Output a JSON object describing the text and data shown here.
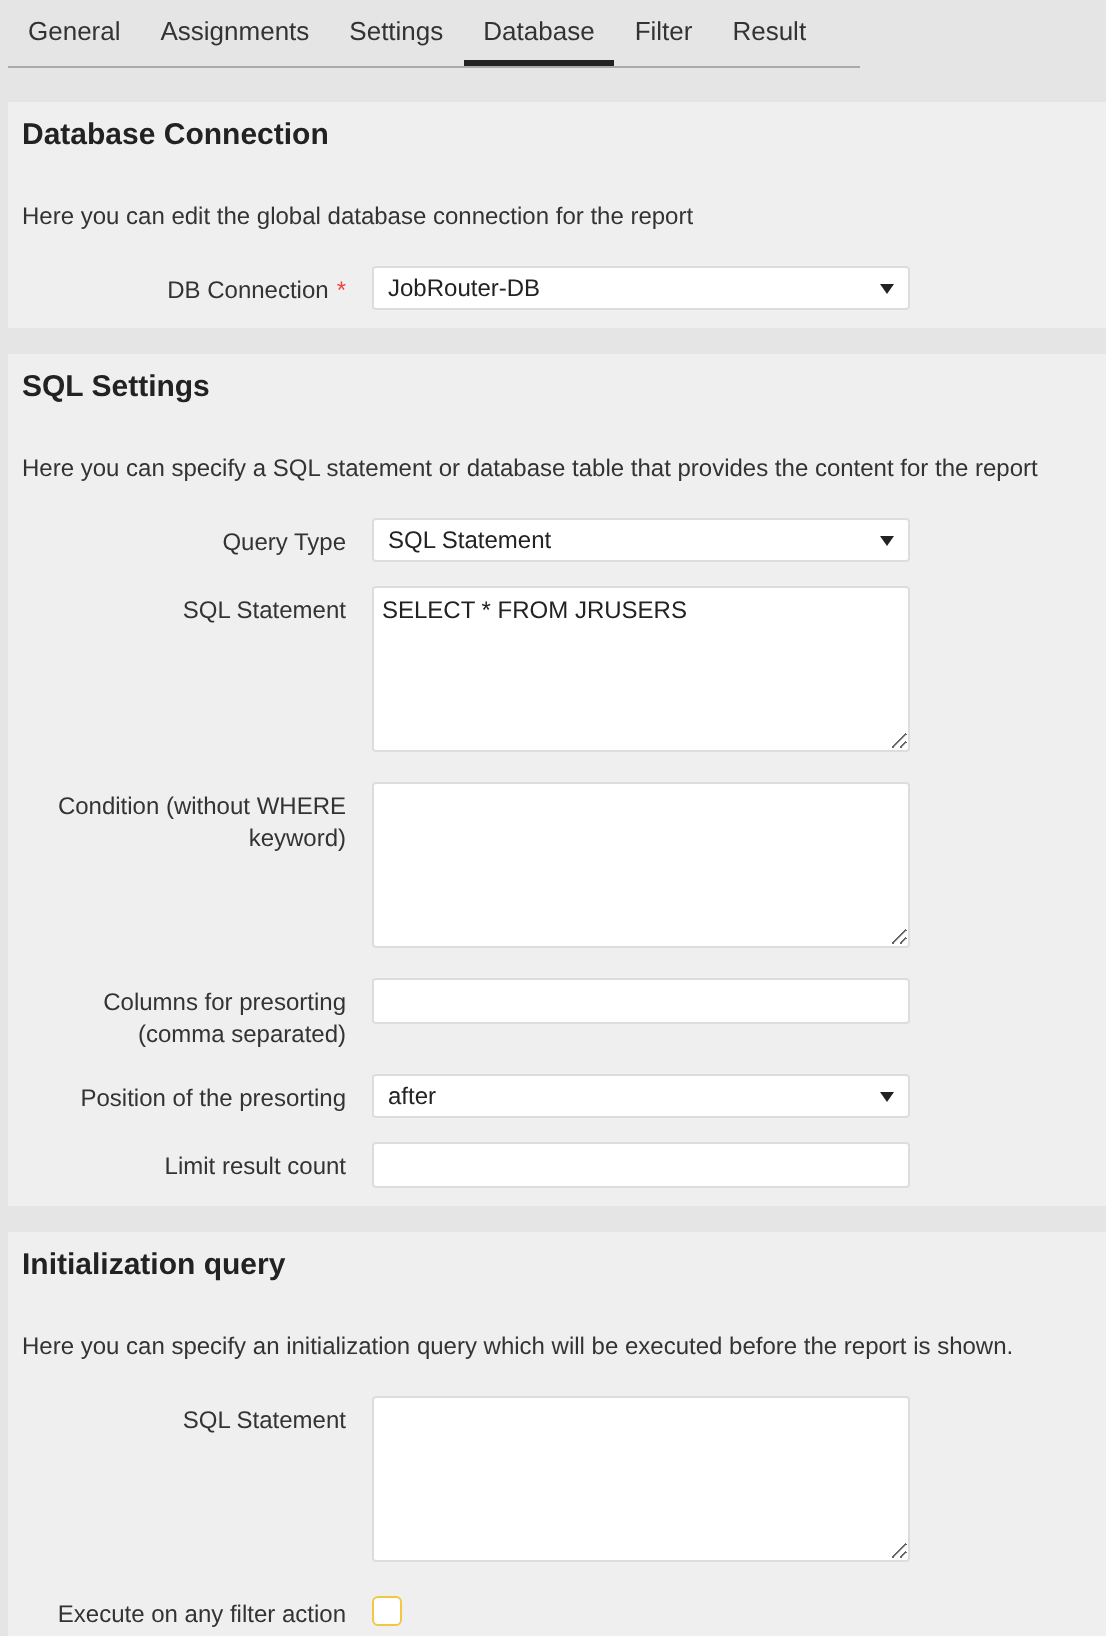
{
  "tabs": [
    {
      "label": "General",
      "selected": false
    },
    {
      "label": "Assignments",
      "selected": false
    },
    {
      "label": "Settings",
      "selected": false
    },
    {
      "label": "Database",
      "selected": true
    },
    {
      "label": "Filter",
      "selected": false
    },
    {
      "label": "Result",
      "selected": false
    }
  ],
  "sections": [
    {
      "title": "Database Connection",
      "description": "Here you can edit the global database connection for the report",
      "fields": [
        {
          "kind": "select",
          "label": "DB Connection",
          "required_mark": "*",
          "value": "JobRouter-DB"
        }
      ]
    },
    {
      "title": "SQL Settings",
      "description": "Here you can specify a SQL statement or database table that provides the content for the report",
      "fields": [
        {
          "kind": "select",
          "label": "Query Type",
          "value": "SQL Statement"
        },
        {
          "kind": "textarea",
          "label": "SQL Statement",
          "value": "SELECT * FROM JRUSERS"
        },
        {
          "kind": "textarea",
          "label": "Condition (without WHERE keyword)"
        },
        {
          "kind": "input",
          "label": "Columns for presorting (comma separated)"
        },
        {
          "kind": "select",
          "label": "Position of the presorting",
          "value": "after"
        },
        {
          "kind": "input",
          "label": "Limit result count"
        }
      ]
    },
    {
      "title": "Initialization query",
      "description": "Here you can specify an initialization query which will be executed before the report is shown.",
      "fields": [
        {
          "kind": "textarea",
          "label": "SQL Statement"
        },
        {
          "kind": "checkbox",
          "label": "Execute on any filter action",
          "checked": false
        }
      ]
    }
  ]
}
